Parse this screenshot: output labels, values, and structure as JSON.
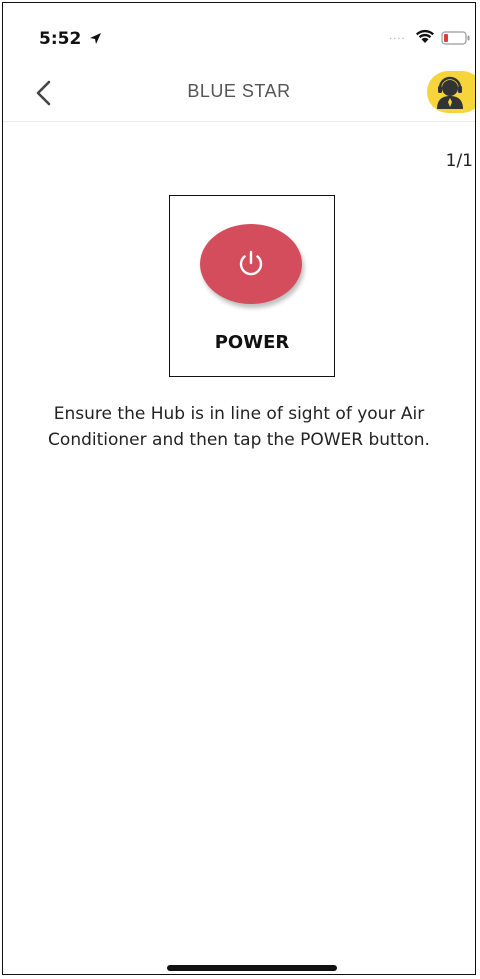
{
  "status_bar": {
    "time": "5:52",
    "signal": "....",
    "icons": [
      "location-arrow-icon",
      "wifi-icon",
      "battery-low-icon"
    ]
  },
  "nav": {
    "back_icon": "chevron-left-icon",
    "title": "BLUE STAR",
    "support_icon": "support-agent-icon"
  },
  "page_counter": "1/1",
  "power_card": {
    "icon": "power-icon",
    "label": "POWER"
  },
  "instructions": "Ensure the Hub is in line of sight of your Air Conditioner and then tap the POWER button.",
  "colors": {
    "power_button": "#d44d5c",
    "support_button": "#f5d53a",
    "battery_low": "#e23a3a"
  }
}
